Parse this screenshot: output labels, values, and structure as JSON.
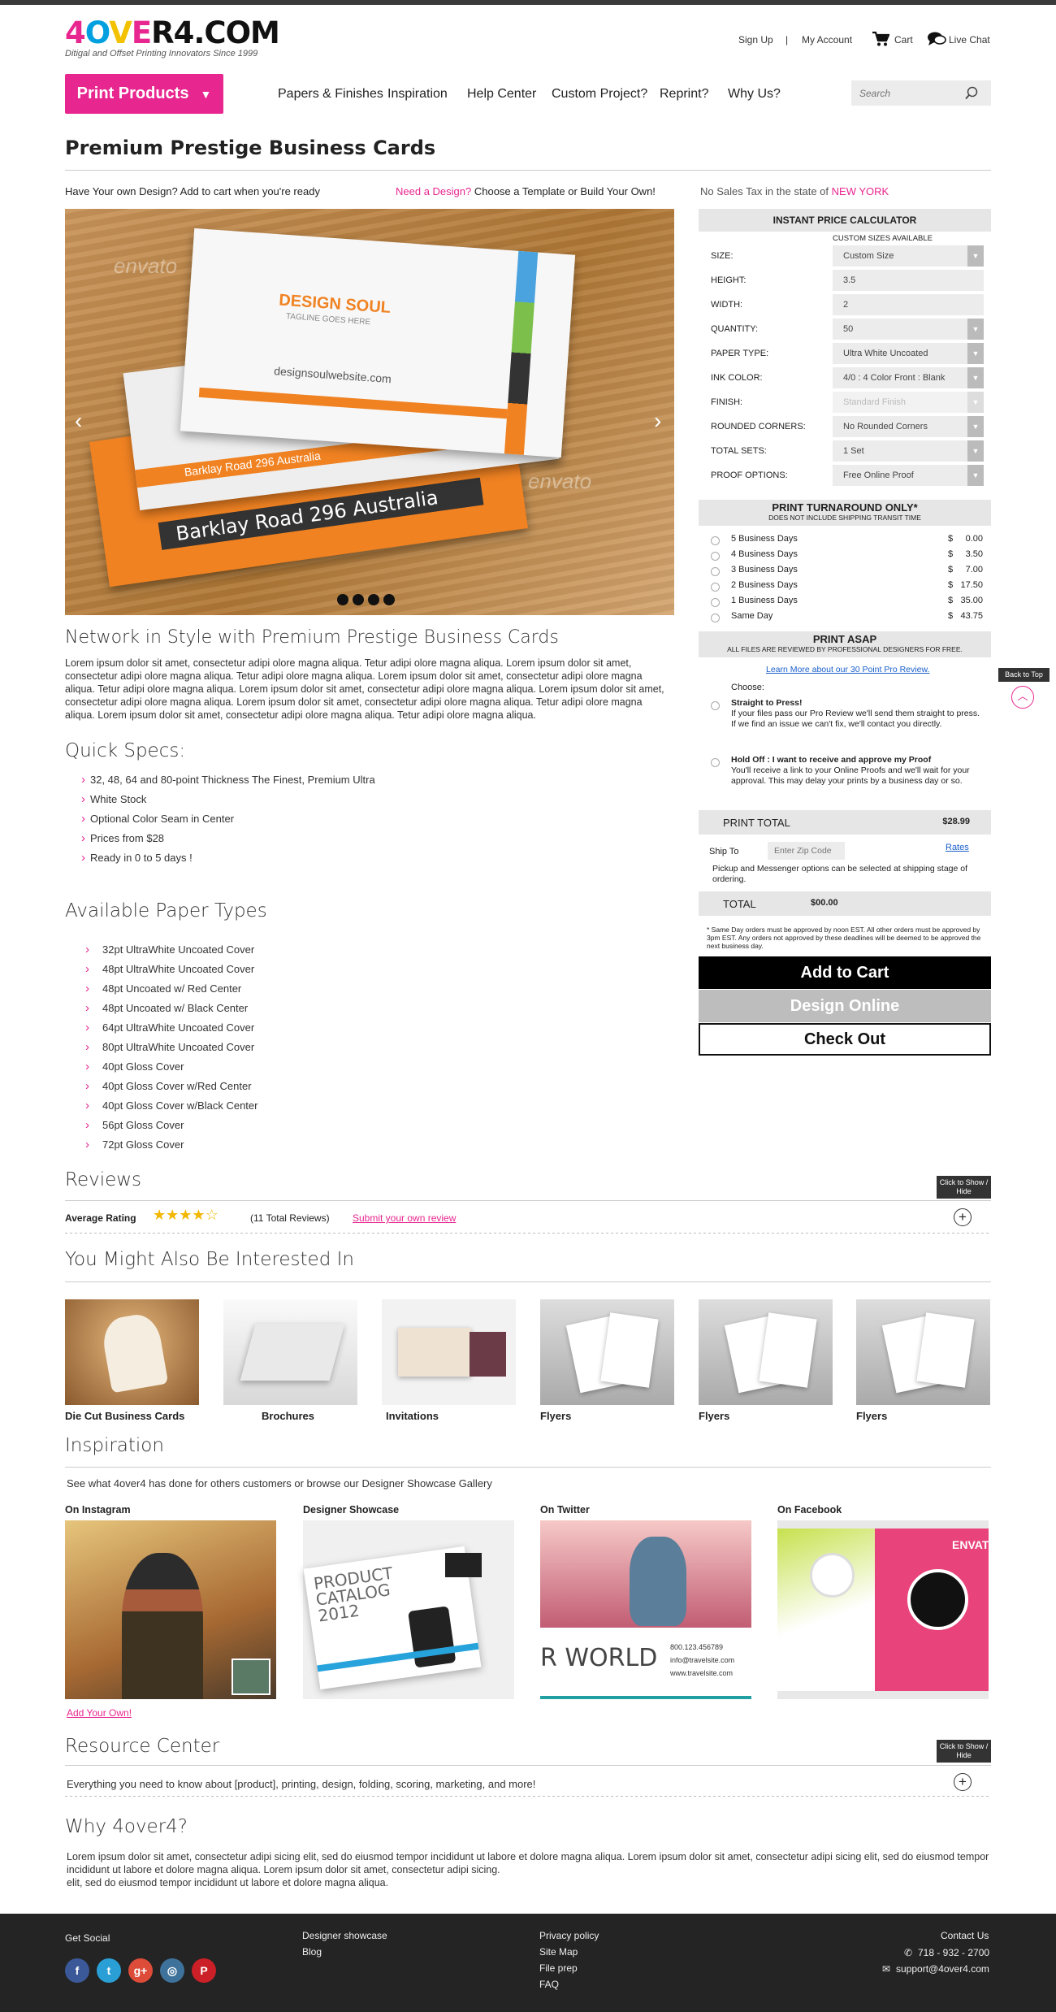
{
  "header": {
    "logo": "4OVER4.COM",
    "tagline": "Ditigal and Offset Printing Innovators Since 1999",
    "signup": "Sign Up",
    "sep": "|",
    "account": "My Account",
    "cart": "Cart",
    "livechat": "Live Chat"
  },
  "nav": {
    "print_products": "Print Products",
    "items": [
      "Papers & Finishes",
      "Inspiration",
      "Help Center",
      "Custom Project?",
      "Reprint?",
      "Why Us?"
    ],
    "search_placeholder": "Search"
  },
  "product": {
    "title": "Premium Prestige Business Cards",
    "own_design": "Have Your own Design?  Add to cart when you're ready",
    "need_design": "Need a Design?",
    "template": " Choose a Template or Build Your Own!",
    "tax_prefix": "No Sales Tax in the state of",
    "tax_state": "NEW YORK"
  },
  "hero": {
    "card_brand": "DESIGN SOUL",
    "card_tagline": "TAGLINE GOES HERE",
    "card_url": "designsoulwebsite.com",
    "card_address": "Barklay Road 296 Australia",
    "watermark": "envato"
  },
  "description": {
    "heading": "Network in Style with Premium Prestige Business Cards",
    "body": "Lorem ipsum dolor sit amet, consectetur adipi olore magna aliqua. Tetur adipi olore magna aliqua. Lorem ipsum dolor sit amet, consectetur adipi olore magna aliqua. Tetur adipi olore magna aliqua. Lorem ipsum dolor sit amet, consectetur adipi olore magna aliqua. Tetur adipi olore magna aliqua. Lorem ipsum dolor sit amet, consectetur adipi olore magna aliqua. Lorem ipsum dolor sit amet, consectetur adipi olore magna aliqua. Lorem ipsum dolor sit amet, consectetur adipi olore magna aliqua. Tetur adipi olore magna aliqua. Lorem ipsum dolor sit amet, consectetur adipi olore magna aliqua. Tetur adipi olore magna aliqua."
  },
  "specs": {
    "heading": "Quick Specs:",
    "items": [
      "32, 48, 64 and 80-point Thickness The Finest, Premium Ultra",
      "White Stock",
      "Optional Color Seam in Center",
      "Prices from $28",
      "Ready in 0 to 5 days !"
    ]
  },
  "papers": {
    "heading": "Available Paper Types",
    "items": [
      "32pt UltraWhite Uncoated Cover",
      "48pt UltraWhite Uncoated Cover",
      "48pt Uncoated w/ Red Center",
      "48pt Uncoated w/ Black Center",
      "64pt UltraWhite Uncoated Cover",
      "80pt UltraWhite Uncoated Cover",
      "40pt Gloss Cover",
      "40pt Gloss Cover w/Red Center",
      "40pt Gloss Cover w/Black Center",
      "56pt Gloss Cover",
      "72pt Gloss Cover"
    ]
  },
  "calculator": {
    "title": "INSTANT PRICE CALCULATOR",
    "custom_sizes": "CUSTOM SIZES AVAILABLE",
    "fields": [
      {
        "label": "SIZE:",
        "value": "Custom Size"
      },
      {
        "label": "HEIGHT:",
        "value": "3.5"
      },
      {
        "label": "WIDTH:",
        "value": "2"
      },
      {
        "label": "QUANTITY:",
        "value": "50"
      },
      {
        "label": "PAPER TYPE:",
        "value": "Ultra White Uncoated"
      },
      {
        "label": "INK COLOR:",
        "value": "4/0 : 4 Color Front : Blank"
      },
      {
        "label": "FINISH:",
        "value": "Standard Finish"
      },
      {
        "label": "ROUNDED CORNERS:",
        "value": "No Rounded Corners"
      },
      {
        "label": "TOTAL SETS:",
        "value": "1 Set"
      },
      {
        "label": "PROOF OPTIONS:",
        "value": "Free Online Proof"
      }
    ],
    "turnaround_title": "PRINT TURNAROUND ONLY*",
    "turnaround_sub": "DOES NOT INCLUDE SHIPPING TRANSIT TIME",
    "turnaround": [
      {
        "label": "5 Business Days",
        "cur": "$",
        "price": "0.00"
      },
      {
        "label": "4 Business Days",
        "cur": "$",
        "price": "3.50"
      },
      {
        "label": "3 Business Days",
        "cur": "$",
        "price": "7.00"
      },
      {
        "label": "2 Business Days",
        "cur": "$",
        "price": "17.50"
      },
      {
        "label": "1 Business Days",
        "cur": "$",
        "price": "35.00"
      },
      {
        "label": "Same Day",
        "cur": "$",
        "price": "43.75"
      }
    ],
    "asap_title": "PRINT ASAP",
    "asap_sub": "ALL FILES ARE REVIEWED BY PROFESSIONAL DESIGNERS FOR FREE.",
    "learn_more": "Learn More about our 30 Point Pro Review.",
    "choose": "Choose:",
    "opt1_title": "Straight to Press!",
    "opt1_body": "If your files pass our Pro Review we'll send them straight to press. If we find an issue we can't fix, we'll contact you directly.",
    "opt2_title": "Hold Off : I want to receive and approve my Proof",
    "opt2_body": "You'll receive a link to your Online Proofs and we'll wait for your approval. This may delay your prints by a business day or so.",
    "print_total_label": "PRINT TOTAL",
    "print_total": "$28.99",
    "ship_to": "Ship To",
    "zip_placeholder": "Enter Zip Code",
    "rates": "Rates",
    "pickup": "Pickup and Messenger options can be selected at shipping stage of ordering.",
    "total_label": "TOTAL",
    "total": "$00.00",
    "note": "* Same Day orders must be approved by noon EST. All other orders must be approved by 3pm EST. Any orders not approved by these deadlines will be deemed to be approved the next business day.",
    "add_to_cart": "Add to Cart",
    "design_online": "Design Online",
    "check_out": "Check Out"
  },
  "back_to_top": "Back to Top",
  "reviews": {
    "heading": "Reviews",
    "avg_label": "Average Rating",
    "rating": 4,
    "rating_max": 5,
    "total": "(11 Total Reviews)",
    "submit": "Submit your own review",
    "toggle": "Click to Show / Hide"
  },
  "related": {
    "heading": "You Might Also Be Interested In",
    "items": [
      "Die Cut Business Cards",
      "Brochures",
      "Invitations",
      "Flyers",
      "Flyers",
      "Flyers"
    ]
  },
  "inspiration": {
    "heading": "Inspiration",
    "intro": "See what 4over4 has done for others customers or browse our  Designer Showcase Gallery",
    "cols": [
      "On Instagram",
      "Designer Showcase",
      "On Twitter",
      "On Facebook"
    ],
    "add_own": "Add Your Own!",
    "catalog_text": "PRODUCT CATALOG 2012",
    "world_text": "R WORLD",
    "envato_text": "ENVATO",
    "phone_text": "800.123.456789",
    "email_text": "info@travelsite.com",
    "site_text": "www.travelsite.com"
  },
  "resource": {
    "heading": "Resource Center",
    "body": "Everything you need to know about [product], printing, design, folding, scoring, marketing, and more!",
    "toggle": "Click to Show / Hide"
  },
  "why": {
    "heading": "Why 4over4?",
    "body": "Lorem ipsum dolor sit amet, consectetur adipi sicing elit, sed do eiusmod tempor incididunt ut labore et dolore magna aliqua. Lorem ipsum dolor sit amet, consectetur adipi sicing elit, sed do eiusmod tempor incididunt ut labore et dolore magna aliqua. Lorem ipsum dolor sit amet, consectetur adipi sicing.",
    "body2": " elit, sed do eiusmod tempor incididunt ut labore et dolore magna aliqua."
  },
  "footer": {
    "get_social": "Get Social",
    "col2": [
      "Designer showcase",
      "Blog"
    ],
    "col3": [
      "Privacy policy",
      "Site Map",
      "File prep",
      "FAQ"
    ],
    "contact": "Contact Us",
    "phone": "718 - 932 - 2700",
    "email": "support@4over4.com",
    "social_glyphs": [
      "f",
      "t",
      "g+",
      "◎",
      "P"
    ]
  },
  "colors": {
    "accent": "#e8268f",
    "link": "#1a5fc9",
    "footer": "#242424"
  }
}
